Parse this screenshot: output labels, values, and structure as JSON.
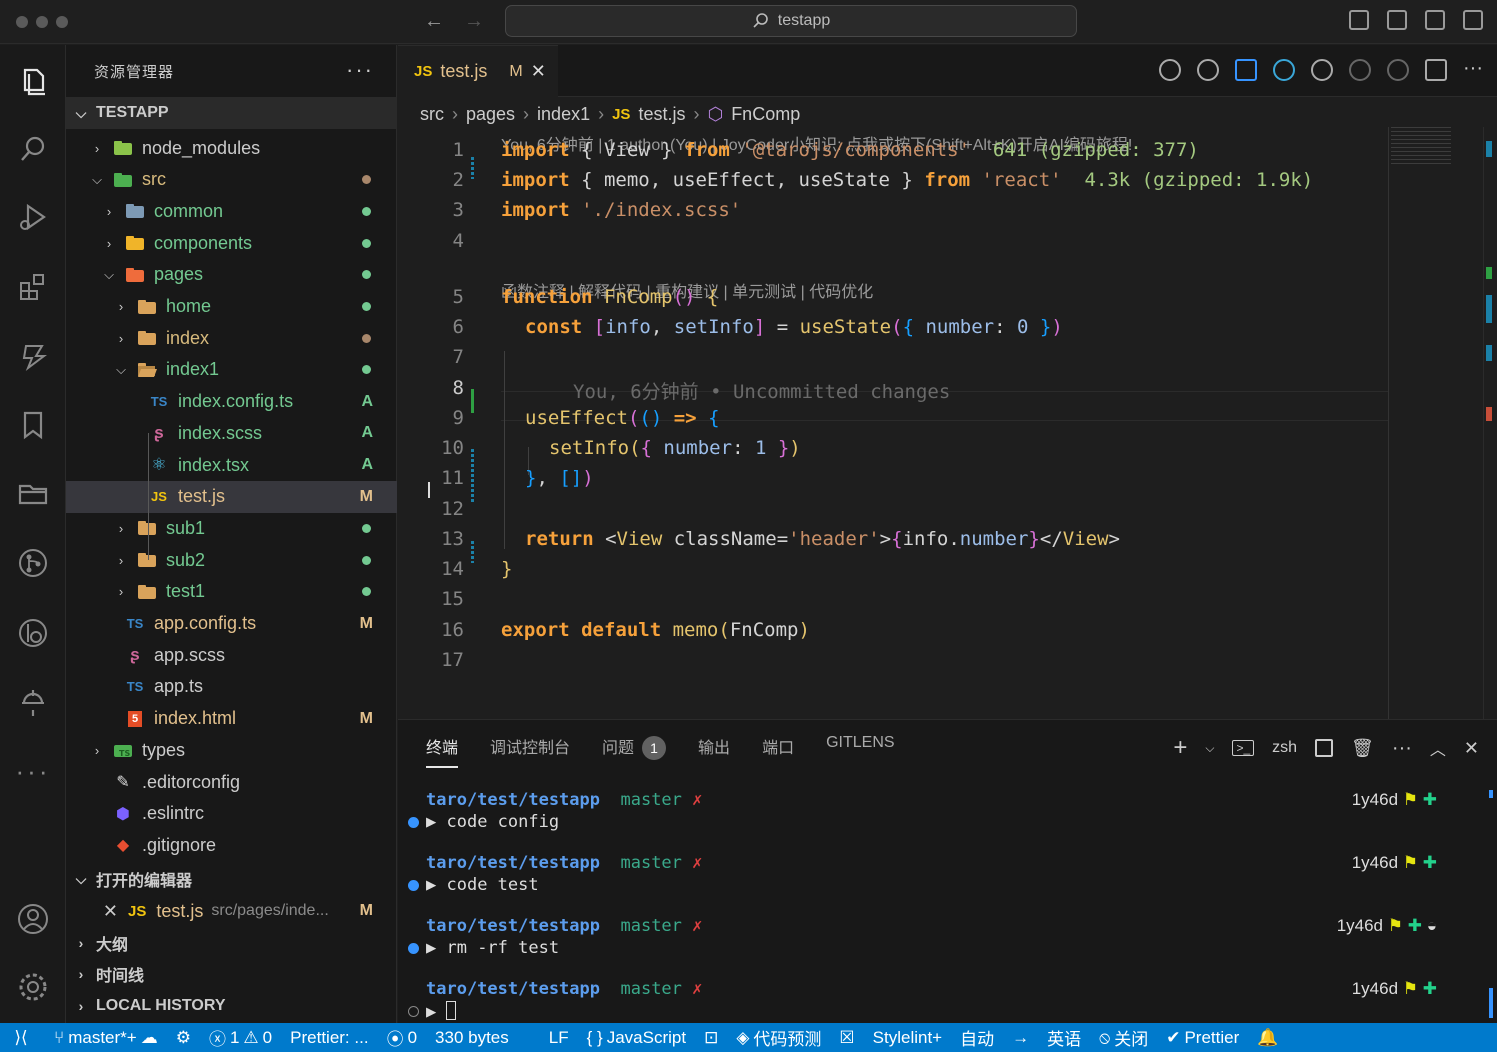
{
  "window": {
    "search": "testapp"
  },
  "sidebar": {
    "title": "资源管理器",
    "root": "TESTAPP",
    "tree": [
      {
        "name": "node_modules",
        "type": "folder",
        "open": false,
        "depth": 1,
        "icon": "node-folder-icon"
      },
      {
        "name": "src",
        "type": "folder",
        "open": true,
        "depth": 1,
        "icon": "src-folder-icon",
        "dot": "#a8876b"
      },
      {
        "name": "common",
        "type": "folder",
        "open": false,
        "depth": 2,
        "icon": "common-folder-icon",
        "dot": "#73c991"
      },
      {
        "name": "components",
        "type": "folder",
        "open": false,
        "depth": 2,
        "icon": "components-folder-icon",
        "dot": "#73c991"
      },
      {
        "name": "pages",
        "type": "folder",
        "open": true,
        "depth": 2,
        "icon": "pages-folder-icon",
        "dot": "#73c991"
      },
      {
        "name": "home",
        "type": "folder",
        "open": false,
        "depth": 3,
        "icon": "folder-icon",
        "dot": "#73c991"
      },
      {
        "name": "index",
        "type": "folder",
        "open": false,
        "depth": 3,
        "icon": "folder-icon",
        "dot": "#a8876b"
      },
      {
        "name": "index1",
        "type": "folder",
        "open": true,
        "depth": 3,
        "icon": "folder-open-icon",
        "dot": "#73c991"
      },
      {
        "name": "index.config.ts",
        "type": "file",
        "depth": 4,
        "icon": "ts-icon",
        "status": "A"
      },
      {
        "name": "index.scss",
        "type": "file",
        "depth": 4,
        "icon": "scss-icon",
        "status": "A"
      },
      {
        "name": "index.tsx",
        "type": "file",
        "depth": 4,
        "icon": "react-icon",
        "status": "A"
      },
      {
        "name": "test.js",
        "type": "file",
        "depth": 4,
        "icon": "js-icon",
        "status": "M",
        "selected": true
      },
      {
        "name": "sub1",
        "type": "folder",
        "open": false,
        "depth": 3,
        "icon": "folder-icon",
        "dot": "#73c991"
      },
      {
        "name": "sub2",
        "type": "folder",
        "open": false,
        "depth": 3,
        "icon": "folder-icon",
        "dot": "#73c991"
      },
      {
        "name": "test1",
        "type": "folder",
        "open": false,
        "depth": 3,
        "icon": "folder-icon",
        "dot": "#73c991"
      },
      {
        "name": "app.config.ts",
        "type": "file",
        "depth": 2,
        "icon": "ts-icon",
        "status": "M"
      },
      {
        "name": "app.scss",
        "type": "file",
        "depth": 2,
        "icon": "scss-icon"
      },
      {
        "name": "app.ts",
        "type": "file",
        "depth": 2,
        "icon": "ts-icon"
      },
      {
        "name": "index.html",
        "type": "file",
        "depth": 2,
        "icon": "html-icon",
        "status": "M"
      },
      {
        "name": "types",
        "type": "folder",
        "open": false,
        "depth": 1,
        "icon": "types-folder-icon"
      },
      {
        "name": ".editorconfig",
        "type": "file",
        "depth": 1,
        "icon": "editorconfig-icon"
      },
      {
        "name": ".eslintrc",
        "type": "file",
        "depth": 1,
        "icon": "eslint-icon"
      },
      {
        "name": ".gitignore",
        "type": "file",
        "depth": 1,
        "icon": "git-icon"
      }
    ],
    "open_editors": {
      "title": "打开的编辑器",
      "file": "test.js",
      "path": "src/pages/inde...",
      "status": "M"
    },
    "outline": "大纲",
    "timeline": "时间线",
    "local_history": "LOCAL HISTORY"
  },
  "editor": {
    "tab": {
      "label": "test.js",
      "badge": "JS",
      "status": "M"
    },
    "breadcrumb": [
      "src",
      "pages",
      "index1",
      "test.js",
      "FnComp"
    ],
    "lens_top": "You, 6分钟前 | 1 author (You) | JoyCoder小知识: 点我或按下(Shift+Alt+K)开启AI编码旅程!",
    "lens_mid": "函数注释 | 解释代码 | 重构建议 | 单元测试 | 代码优化",
    "line_numbers": [
      "1",
      "2",
      "3",
      "4",
      "5",
      "6",
      "7",
      "8",
      "9",
      "10",
      "11",
      "12",
      "13",
      "14",
      "15",
      "16",
      "17"
    ],
    "lines": {
      "l1": [
        "import",
        " { ",
        "View",
        " } ",
        "from",
        " '@tarojs/components'",
        "  641 (gzipped: 377)"
      ],
      "l2": [
        "import",
        " { ",
        "memo",
        ", ",
        "useEffect",
        ", ",
        "useState",
        " } ",
        "from",
        " 'react'",
        "  4.3k (gzipped: 1.9k)"
      ],
      "l3": [
        "import",
        " './index.scss'"
      ],
      "l5": [
        "function",
        " FnComp",
        "()",
        " {"
      ],
      "l6": [
        "const",
        " [",
        "info",
        ", ",
        "setInfo",
        "]",
        " = ",
        "useState",
        "(",
        "{ ",
        "number",
        ": ",
        "0",
        " }",
        ")"
      ],
      "l8": "You, 6分钟前 • Uncommitted changes",
      "l9": [
        "useEffect",
        "(",
        "()",
        " => ",
        "{"
      ],
      "l10": [
        "setInfo",
        "(",
        "{ ",
        "number",
        ": ",
        "1",
        " }",
        ")"
      ],
      "l11": [
        "}",
        ", ",
        "[",
        "]",
        ")"
      ],
      "l13": [
        "return",
        " <",
        "View",
        " className",
        "=",
        "'header'",
        ">",
        "{",
        "info",
        ".",
        "number",
        "}",
        "</",
        "View",
        ">"
      ],
      "l14": [
        "}"
      ],
      "l16": [
        "export",
        " default",
        " memo",
        "(",
        "FnComp",
        ")"
      ]
    }
  },
  "panel": {
    "tabs": [
      "终端",
      "调试控制台",
      "问题",
      "输出",
      "端口",
      "GITLENS"
    ],
    "problems_count": "1",
    "shell": "zsh",
    "entries": [
      {
        "path": "taro/test/testapp",
        "branch": "master",
        "x": "✗",
        "cmd": "code config",
        "age": "1y46d",
        "bullet": "#3794ff"
      },
      {
        "path": "taro/test/testapp",
        "branch": "master",
        "x": "✗",
        "cmd": "code test",
        "age": "1y46d",
        "bullet": "#3794ff"
      },
      {
        "path": "taro/test/testapp",
        "branch": "master",
        "x": "✗",
        "cmd": "rm -rf test",
        "age": "1y46d",
        "bullet": "#3794ff"
      },
      {
        "path": "taro/test/testapp",
        "branch": "master",
        "x": "✗",
        "cmd": "",
        "age": "1y46d",
        "bullet": "none"
      }
    ]
  },
  "status": {
    "branch": "master*+",
    "errors": "1",
    "warnings": "0",
    "prettier_short": "Prettier: ...",
    "ports": "0",
    "size": "330 bytes",
    "eol": "LF",
    "lang": "JavaScript",
    "predict": "代码预测",
    "stylelint": "Stylelint+",
    "auto": "自动",
    "english": "英语",
    "close": "关闭",
    "prettier": "Prettier"
  }
}
